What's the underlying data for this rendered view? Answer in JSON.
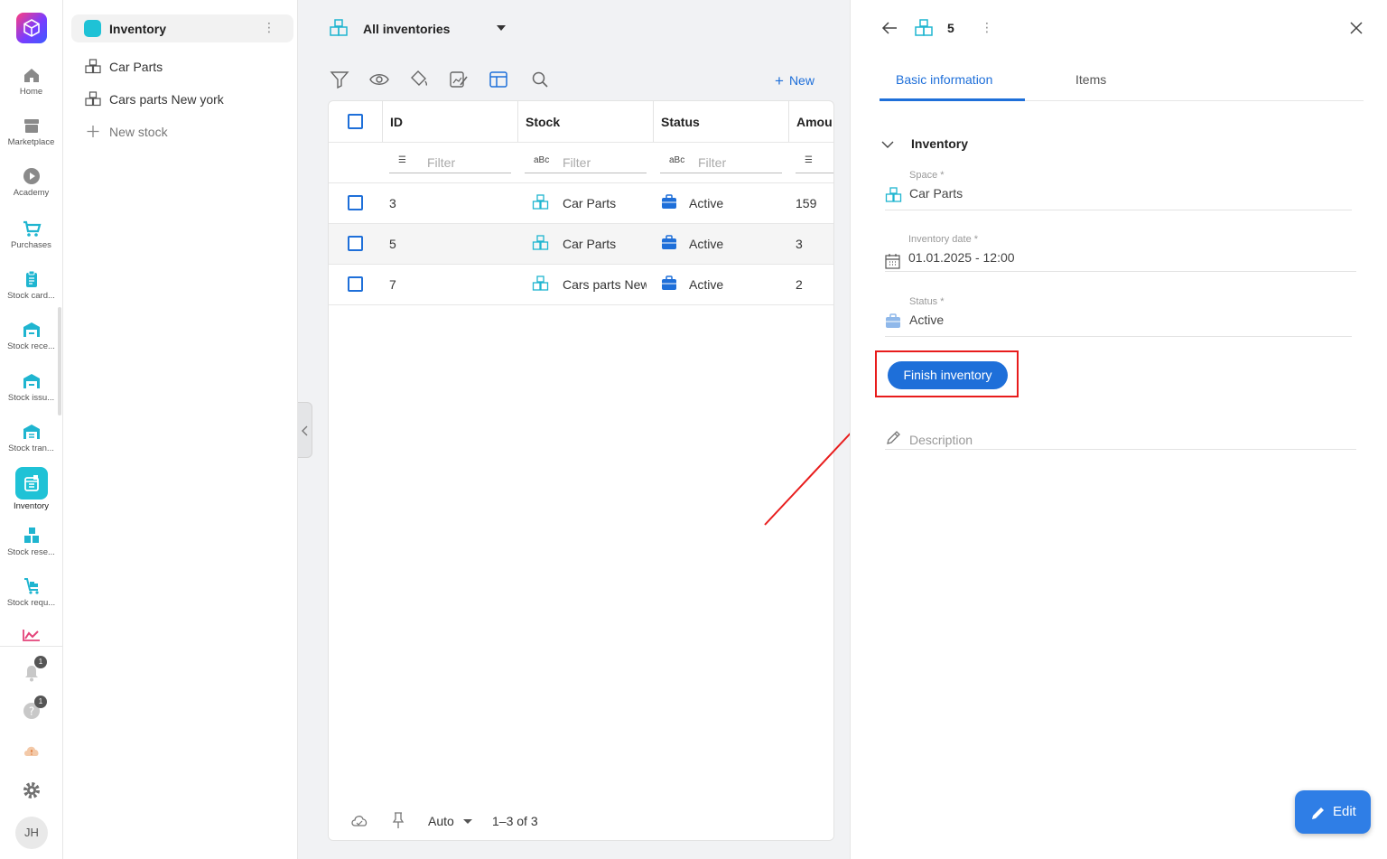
{
  "rail": {
    "items": [
      {
        "label": "Home",
        "icon": "home-icon"
      },
      {
        "label": "Marketplace",
        "icon": "store-icon"
      },
      {
        "label": "Academy",
        "icon": "play-icon"
      },
      {
        "label": "Purchases",
        "icon": "cart-icon"
      },
      {
        "label": "Stock card...",
        "icon": "clipboard-icon"
      },
      {
        "label": "Stock rece...",
        "icon": "warehouse-in-icon"
      },
      {
        "label": "Stock issu...",
        "icon": "warehouse-out-icon"
      },
      {
        "label": "Stock tran...",
        "icon": "warehouse-transfer-icon"
      },
      {
        "label": "Inventory",
        "icon": "inventory-icon"
      },
      {
        "label": "Stock rese...",
        "icon": "boxes-icon"
      },
      {
        "label": "Stock requ...",
        "icon": "cart-request-icon"
      }
    ],
    "notifications_badge": "1",
    "help_badge": "1",
    "avatar_initials": "JH"
  },
  "nav": {
    "title": "Inventory",
    "items": [
      {
        "label": "Car Parts"
      },
      {
        "label": "Cars parts New york"
      }
    ],
    "new_stock_label": "New stock"
  },
  "main": {
    "title": "All inventories",
    "new_label": "New",
    "columns": [
      "ID",
      "Stock",
      "Status",
      "Amou"
    ],
    "filter_placeholder": "Filter",
    "rows": [
      {
        "id": "3",
        "stock": "Car Parts",
        "status": "Active",
        "amount": "159"
      },
      {
        "id": "5",
        "stock": "Car Parts",
        "status": "Active",
        "amount": "3"
      },
      {
        "id": "7",
        "stock": "Cars parts New",
        "status": "Active",
        "amount": "2"
      }
    ],
    "footer": {
      "density": "Auto",
      "pagination": "1–3 of 3"
    }
  },
  "detail": {
    "record_id": "5",
    "tabs": [
      "Basic information",
      "Items"
    ],
    "section_title": "Inventory",
    "fields": {
      "space": {
        "label": "Space *",
        "value": "Car Parts"
      },
      "date": {
        "label": "Inventory date *",
        "value": "01.01.2025 - 12:00"
      },
      "status": {
        "label": "Status *",
        "value": "Active"
      }
    },
    "finish_label": "Finish inventory",
    "description_placeholder": "Description",
    "edit_label": "Edit"
  },
  "colors": {
    "accent": "#1e6fd9",
    "teal": "#1fc2d6",
    "highlight": "#e81c1c"
  }
}
